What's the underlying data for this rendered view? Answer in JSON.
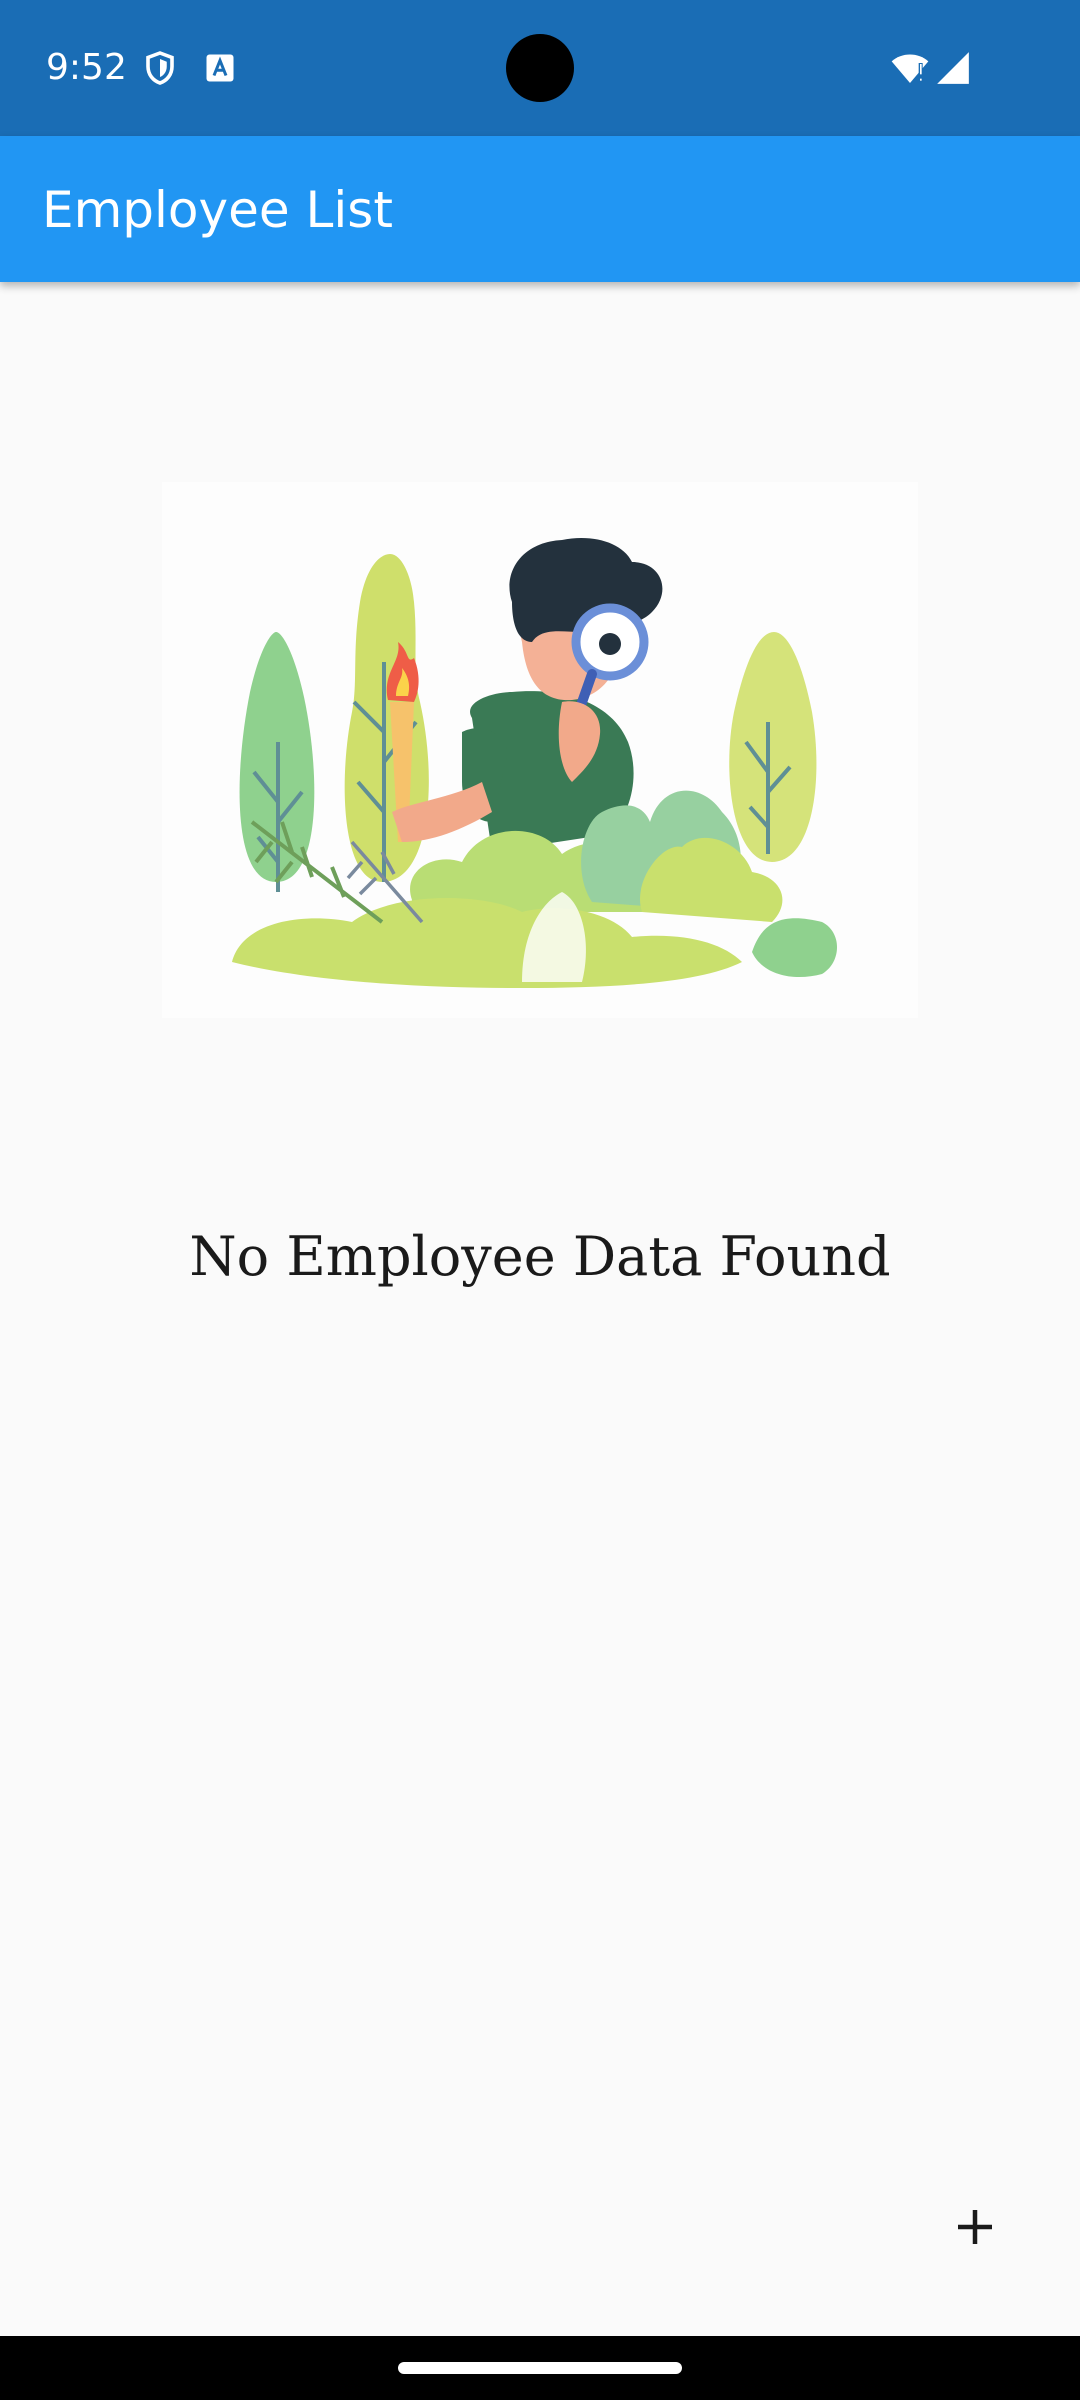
{
  "status_bar": {
    "time": "9:52",
    "icons": [
      "shield-icon",
      "text-a-icon",
      "wifi-alert-icon",
      "signal-icon"
    ],
    "background_color": "#1a6db5"
  },
  "app_bar": {
    "title": "Employee List",
    "background_color": "#2196f3"
  },
  "empty_state": {
    "illustration": "person-searching-with-magnifier-illustration",
    "message": "No Employee Data Found"
  },
  "fab": {
    "icon": "plus-icon"
  },
  "navigation_bar": {
    "handle": "gesture-handle"
  }
}
